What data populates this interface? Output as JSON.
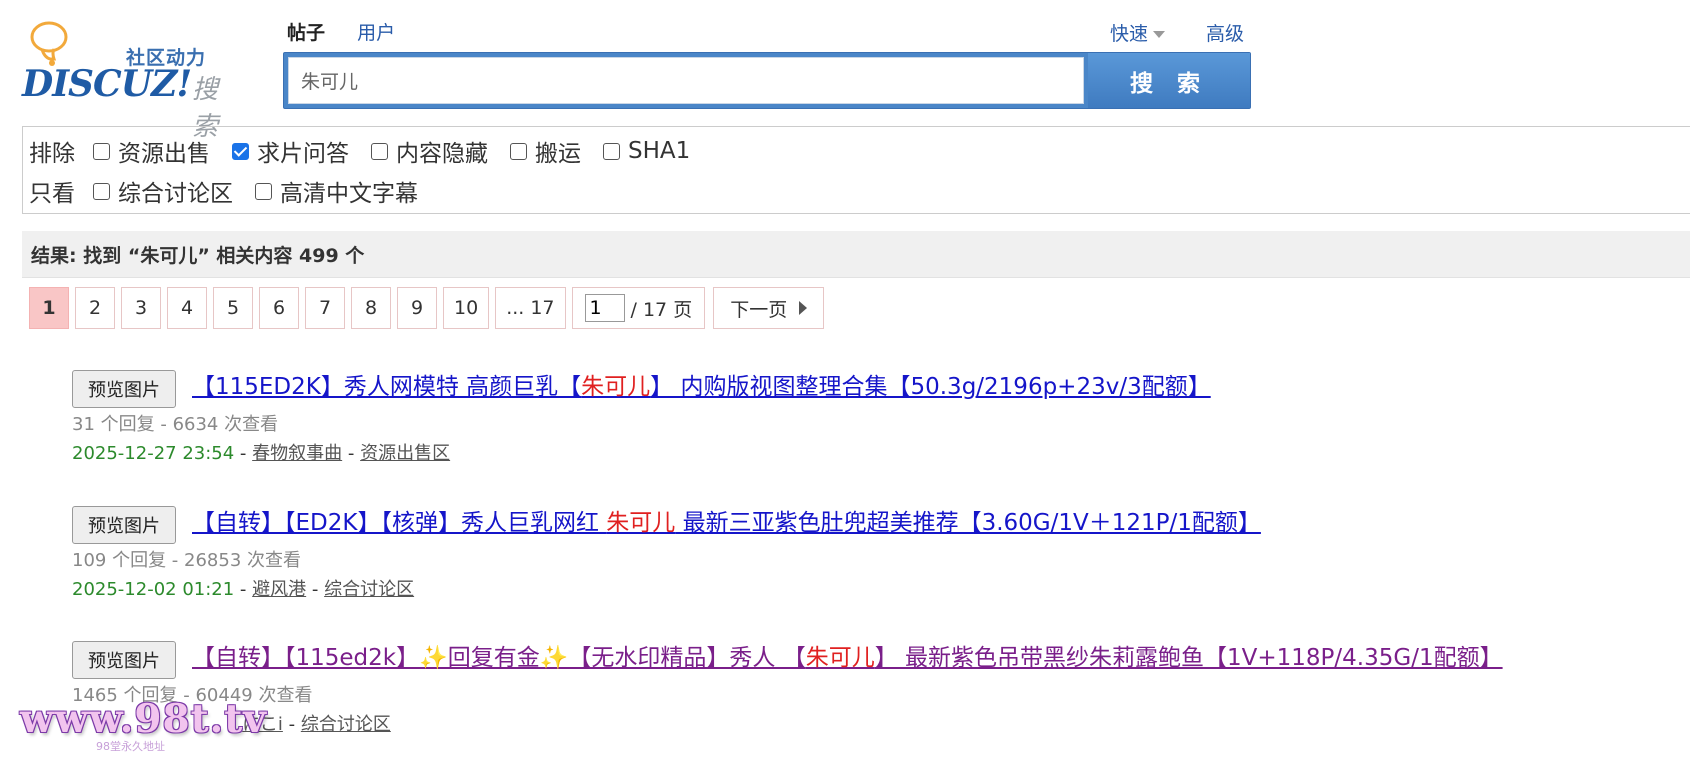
{
  "logo": {
    "sub": "社区动力",
    "brand": "DISCUZ!",
    "suffix": "搜索"
  },
  "tabs": {
    "active": "帖子",
    "other": "用户"
  },
  "header_links": {
    "quick": "快速",
    "advanced": "高级"
  },
  "search": {
    "value": "朱可儿",
    "button": "搜 索"
  },
  "filters": {
    "exclude_label": "排除",
    "exclude": [
      {
        "label": "资源出售",
        "checked": false
      },
      {
        "label": "求片问答",
        "checked": true
      },
      {
        "label": "内容隐藏",
        "checked": false
      },
      {
        "label": "搬运",
        "checked": false
      },
      {
        "label": "SHA1",
        "checked": false
      }
    ],
    "only_label": "只看",
    "only": [
      {
        "label": "综合讨论区",
        "checked": false
      },
      {
        "label": "高清中文字幕",
        "checked": false
      }
    ]
  },
  "result_summary": "结果: 找到 “朱可儿” 相关内容 499 个",
  "pager": {
    "pages": [
      "1",
      "2",
      "3",
      "4",
      "5",
      "6",
      "7",
      "8",
      "9",
      "10",
      "... 17"
    ],
    "current": "1",
    "jump_value": "1",
    "total_text": "/ 17 页",
    "next": "下一页"
  },
  "results": [
    {
      "preview": "预览图片",
      "title_pre": "【115ED2K】秀人网模特 高颜巨乳【",
      "title_hl": "朱可儿",
      "title_post": "】 内购版视图整理合集【50.3g/2196p+23v/3配额】",
      "stats": "31 个回复 - 6634 次查看",
      "date": "2025-12-27 23:54",
      "author": "春物叙事曲",
      "forum": "资源出售区"
    },
    {
      "preview": "预览图片",
      "title_pre": "【自转】【ED2K】【核弹】秀人巨乳网红 ",
      "title_hl": "朱可儿",
      "title_post": " 最新三亚紫色肚兜超美推荐【3.60G/1V＋121P/1配额】",
      "stats": "109 个回复 - 26853 次查看",
      "date": "2025-12-02 01:21",
      "author": "避风港",
      "forum": "综合讨论区"
    },
    {
      "preview": "预览图片",
      "title_pre": "【自转】【115ed2k】✨回复有金✨【无水印精品】秀人 【",
      "title_hl": "朱可儿",
      "title_post": "】 最新紫色吊带黑纱朱莉露鲍鱼【1V+118P/4.35G/1配额】",
      "stats": "1465 个回复 - 60449 次查看",
      "date": "",
      "author": "にこi",
      "forum": "综合讨论区"
    }
  ],
  "meta_sep": " - ",
  "watermark": {
    "text": "www.98t.tv",
    "sub": "98堂永久地址"
  },
  "colors": {
    "accent": "#4a86c8",
    "link": "#1515c9",
    "visited": "#7a1f8a",
    "highlight": "#e02020",
    "date": "#2c8a2c"
  }
}
